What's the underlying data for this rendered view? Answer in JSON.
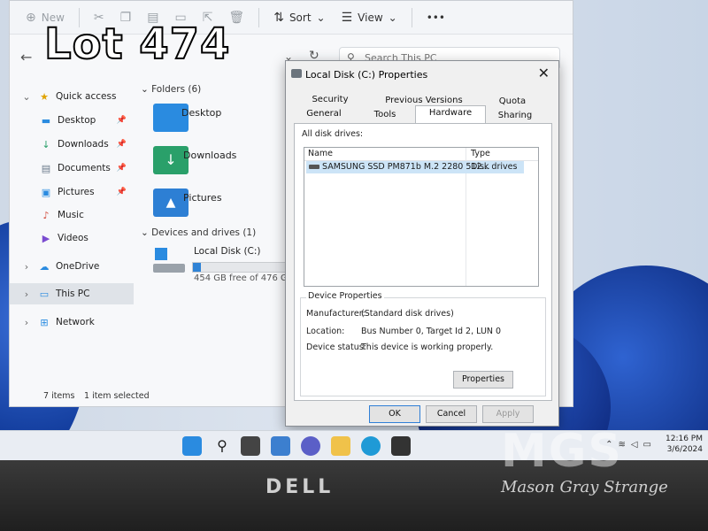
{
  "watermark": {
    "lot": "Lot 474",
    "logo": "MGS",
    "company": "Mason Gray Strange"
  },
  "explorer": {
    "toolbar": {
      "new": "New",
      "sort": "Sort",
      "view": "View",
      "more": "•••"
    },
    "search_placeholder": "Search This PC",
    "sidebar": {
      "quick_access": "Quick access",
      "items": [
        "Desktop",
        "Downloads",
        "Documents",
        "Pictures",
        "Music",
        "Videos"
      ],
      "onedrive": "OneDrive",
      "this_pc": "This PC",
      "network": "Network"
    },
    "folders_header": "Folders (6)",
    "folders": [
      "Desktop",
      "Downloads",
      "Pictures"
    ],
    "devices_header": "Devices and drives (1)",
    "drive": {
      "name": "Local Disk (C:)",
      "free_text": "454 GB free of 476 GB",
      "used_fraction": 0.046
    },
    "status": {
      "items": "7 items",
      "selected": "1 item selected"
    }
  },
  "dialog": {
    "title": "Local Disk (C:) Properties",
    "tabs_row1": [
      "Security",
      "Previous Versions",
      "Quota"
    ],
    "tabs_row2": [
      "General",
      "Tools",
      "Hardware",
      "Sharing"
    ],
    "active_tab": "Hardware",
    "all_disk_drives": "All disk drives:",
    "columns": [
      "Name",
      "Type"
    ],
    "drive_row": {
      "name": "SAMSUNG SSD PM871b M.2 2280 512...",
      "type": "Disk drives"
    },
    "device_properties": "Device Properties",
    "manufacturer_label": "Manufacturer:",
    "manufacturer": "(Standard disk drives)",
    "location_label": "Location:",
    "location": "Bus Number 0, Target Id 2, LUN 0",
    "status_label": "Device status:",
    "status": "This device is working properly.",
    "properties_btn": "Properties",
    "ok": "OK",
    "cancel": "Cancel",
    "apply": "Apply"
  },
  "taskbar": {
    "time": "12:16 PM",
    "date": "3/6/2024"
  },
  "laptop": {
    "brand": "DELL"
  },
  "colors": {
    "accent": "#2f83d6",
    "selection": "#cce4f7",
    "folder_blue": "#2a8be0",
    "folder_green": "#2aa06a"
  }
}
